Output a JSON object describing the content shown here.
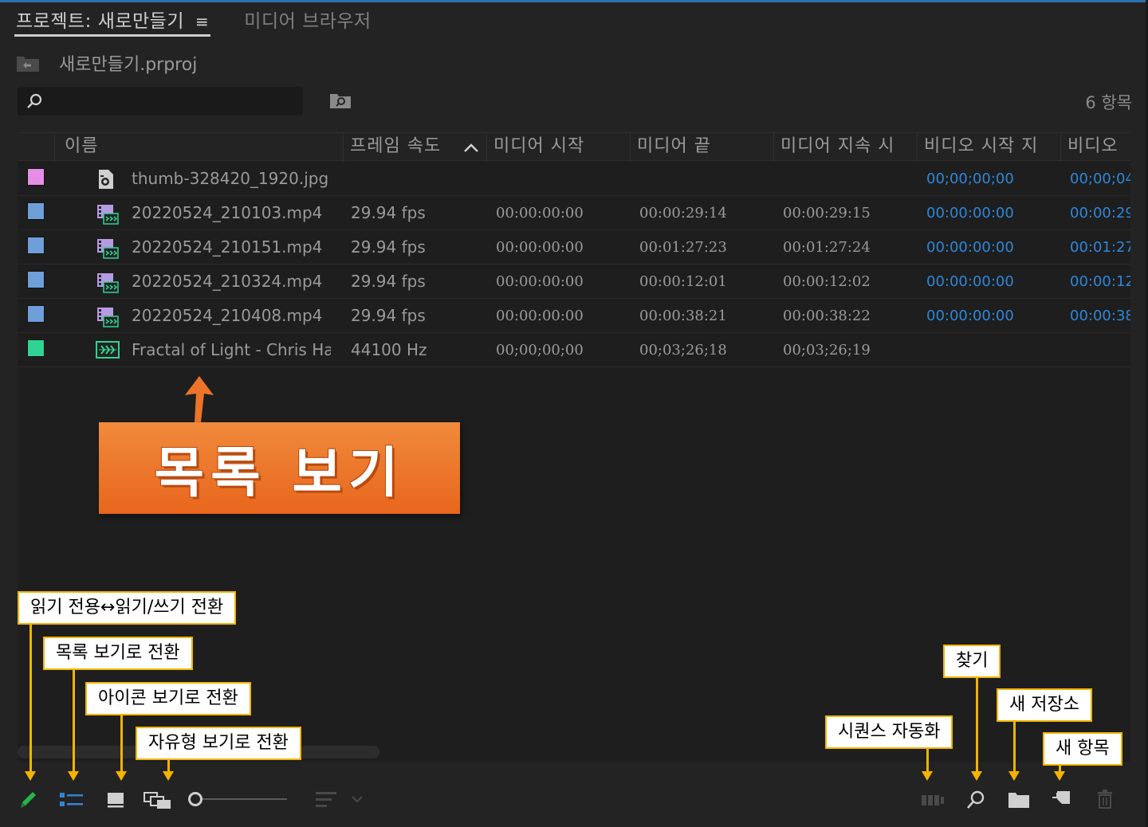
{
  "tabs": {
    "project": "프로젝트: 새로만들기",
    "menu_icon": "≡",
    "media_browser": "미디어 브라우저"
  },
  "project": {
    "name": "새로만들기.prproj"
  },
  "search": {
    "placeholder": "",
    "count": "6 항목"
  },
  "columns": {
    "name": "이름",
    "fps": "프레임 속도",
    "media_start": "미디어 시작",
    "media_end": "미디어 끝",
    "media_duration": "미디어 지속 시",
    "video_in": "비디오 시작 지",
    "video_out": "비디오"
  },
  "rows": [
    {
      "color": "#e58ee6",
      "icon": "image-file-icon",
      "name": "thumb-328420_1920.jpg",
      "fps": "",
      "media_start": "",
      "media_end": "",
      "media_duration": "",
      "video_in": "00;00;00;00",
      "video_out": "00;00;04"
    },
    {
      "color": "#6f9fd8",
      "icon": "video-file-icon",
      "name": "20220524_210103.mp4",
      "fps": "29.94 fps",
      "media_start": "00:00:00:00",
      "media_end": "00:00:29:14",
      "media_duration": "00:00:29:15",
      "video_in": "00:00:00:00",
      "video_out": "00:00:29"
    },
    {
      "color": "#6f9fd8",
      "icon": "video-file-icon",
      "name": "20220524_210151.mp4",
      "fps": "29.94 fps",
      "media_start": "00:00:00:00",
      "media_end": "00:01:27:23",
      "media_duration": "00:01:27:24",
      "video_in": "00:00:00:00",
      "video_out": "00:01:27"
    },
    {
      "color": "#6f9fd8",
      "icon": "video-file-icon",
      "name": "20220524_210324.mp4",
      "fps": "29.94 fps",
      "media_start": "00:00:00:00",
      "media_end": "00:00:12:01",
      "media_duration": "00:00:12:02",
      "video_in": "00:00:00:00",
      "video_out": "00:00:12"
    },
    {
      "color": "#6f9fd8",
      "icon": "video-file-icon",
      "name": "20220524_210408.mp4",
      "fps": "29.94 fps",
      "media_start": "00:00:00:00",
      "media_end": "00:00:38:21",
      "media_duration": "00:00:38:22",
      "video_in": "00:00:00:00",
      "video_out": "00:00:38"
    },
    {
      "color": "#2fd494",
      "icon": "audio-file-icon",
      "name": "Fractal of Light - Chris Ha",
      "fps": "44100 Hz",
      "media_start": "00;00;00;00",
      "media_end": "00;03;26;18",
      "media_duration": "00;03;26;19",
      "video_in": "",
      "video_out": ""
    }
  ],
  "callout": {
    "text": "목록 보기",
    "color": "#ec7428"
  },
  "annotations": {
    "readonly_toggle": "읽기 전용↔읽기/쓰기 전환",
    "list_view": "목록 보기로 전환",
    "icon_view": "아이콘 보기로 전환",
    "freeform_view": "자유형 보기로 전환",
    "automate_sequence": "시퀀스 자동화",
    "find": "찾기",
    "new_bin": "새 저장소",
    "new_item": "새 항목"
  },
  "colors": {
    "accent_blue": "#2f86d8",
    "annotation_border": "#f2b400",
    "pencil_green": "#27b34a"
  }
}
